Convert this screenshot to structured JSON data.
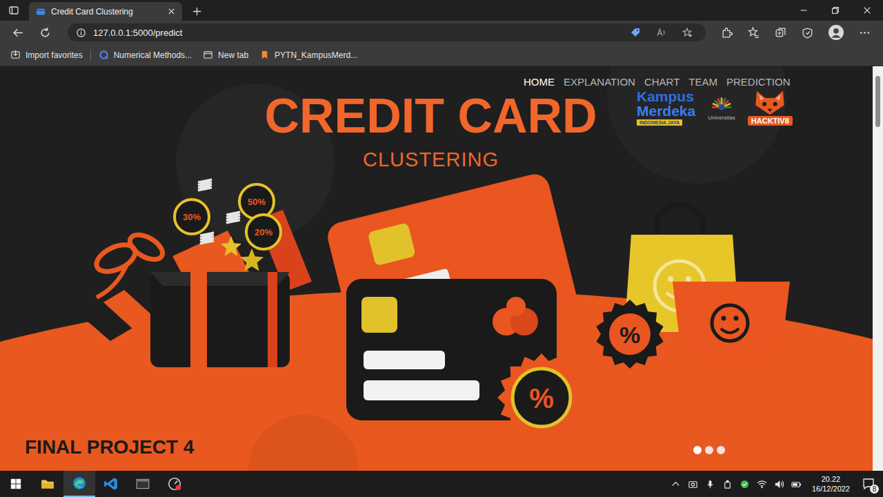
{
  "browser": {
    "tab": {
      "title": "Credit Card Clustering",
      "selected": true
    },
    "url": "127.0.0.1:5000/predict",
    "favorites": [
      "Import favorites",
      "Numerical Methods...",
      "New tab",
      "PYTN_KampusMerd..."
    ]
  },
  "page": {
    "nav": [
      {
        "label": "HOME",
        "selected": true
      },
      {
        "label": "EXPLANATION",
        "selected": false
      },
      {
        "label": "CHART",
        "selected": false
      },
      {
        "label": "TEAM",
        "selected": false
      },
      {
        "label": "PREDICTION",
        "selected": false
      }
    ],
    "logos": {
      "kampus_top": "Kampus",
      "kampus_bottom": "Merdeka",
      "kampus_tag": "INDONESIA JAYA",
      "university": "Universitas",
      "hacktiv8": "HACKTIV8"
    },
    "title": "CREDIT CARD",
    "subtitle": "CLUSTERING",
    "footer": "FINAL PROJECT 4",
    "gift_badges": [
      "30%",
      "50%",
      "20%"
    ],
    "card_badge": "%",
    "bag_badge": "%",
    "carousel": [
      {
        "selected": true
      },
      {
        "selected": false
      },
      {
        "selected": false
      }
    ]
  },
  "taskbar": {
    "time": "20.22",
    "date": "16/12/2022",
    "notifications": "8"
  }
}
